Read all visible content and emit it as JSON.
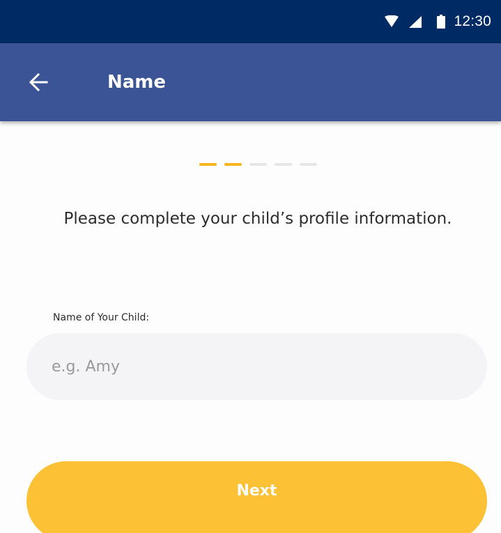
{
  "status_bar": {
    "time": "12:30",
    "icons": [
      "wifi-icon",
      "signal-icon",
      "battery-icon"
    ],
    "background": "#002a63"
  },
  "app_bar": {
    "title": "Name",
    "back_icon": "arrow-left-icon",
    "background": "#3b5496"
  },
  "progress": {
    "total_steps": 5,
    "current_step": 2,
    "active_color": "#f7b51f",
    "inactive_color": "#e6e6e6"
  },
  "form": {
    "instruction": "Please complete your child’s profile information.",
    "name_label": "Name of Your Child:",
    "name_value": "",
    "name_placeholder": "e.g. Amy"
  },
  "actions": {
    "next_label": "Next",
    "next_color": "#fcc134"
  }
}
